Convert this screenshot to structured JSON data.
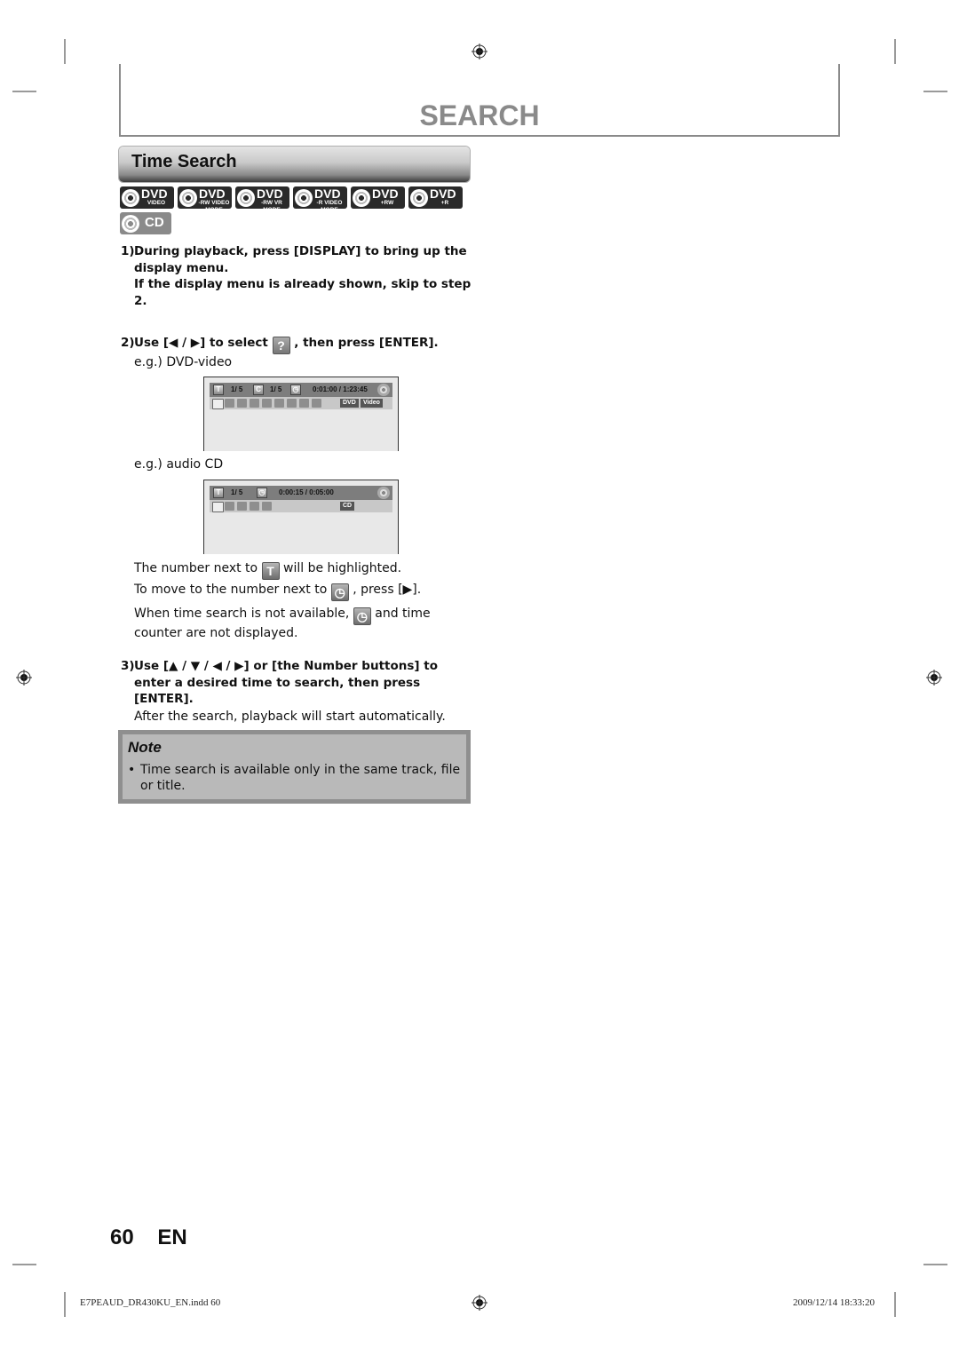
{
  "header": {
    "title": "SEARCH"
  },
  "section": {
    "title": "Time Search"
  },
  "disc_badges": [
    {
      "big": "DVD",
      "small": "VIDEO"
    },
    {
      "big": "DVD",
      "small": "-RW VIDEO MODE"
    },
    {
      "big": "DVD",
      "small": "-RW VR MODE"
    },
    {
      "big": "DVD",
      "small": "-R VIDEO MODE"
    },
    {
      "big": "DVD",
      "small": "+RW"
    },
    {
      "big": "DVD",
      "small": "+R"
    },
    {
      "big": "CD",
      "small": ""
    }
  ],
  "steps": {
    "step1": {
      "num": "1)",
      "line1": "During playback, press [DISPLAY] to bring up the display menu.",
      "line2": "If the display menu is already shown, skip to step 2."
    },
    "step2": {
      "num": "2)",
      "pre": "Use [◀ / ▶] to select",
      "post": ", then press [ENTER].",
      "icon": "time-search-icon",
      "eg_dvd": "e.g.) DVD-video",
      "eg_cd": "e.g.) audio CD"
    },
    "step3": {
      "num": "3)",
      "line1": "Use [▲ / ▼ / ◀ / ▶] or [the Number buttons] to enter a desired time to search, then press [ENTER].",
      "line2": "After the search, playback will start automatically."
    }
  },
  "screens": {
    "dvd": {
      "title_label": "T",
      "title_value": "1/  5",
      "chapter_label": "C",
      "chapter_value": "1/  5",
      "time": "0:01:00 / 1:23:45",
      "tags": [
        "DVD",
        "Video"
      ]
    },
    "cd": {
      "title_label": "T",
      "title_value": "1/  5",
      "time": "0:00:15 / 0:05:00",
      "tags": [
        "CD"
      ]
    }
  },
  "paragraphs": {
    "p1_pre": "The number next to",
    "p1_icon": "T",
    "p1_post": "will be highlighted.",
    "p2_pre": "To move to the number next to",
    "p2_post": ", press [▶].",
    "p3_pre": "When time search is not available,",
    "p3_post": "and time counter are not displayed."
  },
  "note": {
    "title": "Note",
    "bullet": "•",
    "text": "Time search is available only in the same track, file or title."
  },
  "page": {
    "number_label": "60  EN"
  },
  "footer": {
    "file": "E7PEAUD_DR430KU_EN.indd   60",
    "timestamp": "2009/12/14   18:33:20"
  }
}
